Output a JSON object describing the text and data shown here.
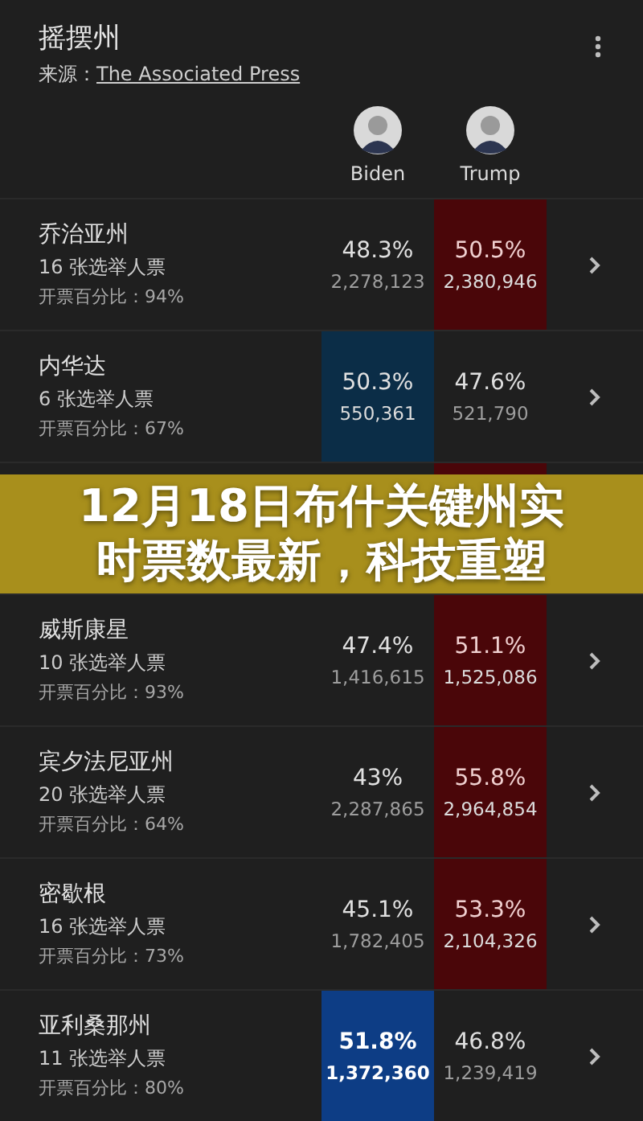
{
  "header": {
    "title": "摇摆州",
    "source_label": "来源：",
    "source_link": "The Associated Press"
  },
  "candidates": [
    {
      "name": "Biden"
    },
    {
      "name": "Trump"
    }
  ],
  "states": [
    {
      "name": "乔治亚州",
      "electors": "16 张选举人票",
      "reported": "开票百分比：94%",
      "biden": {
        "pct": "48.3%",
        "count": "2,278,123",
        "leading": false
      },
      "trump": {
        "pct": "50.5%",
        "count": "2,380,946",
        "leading": true
      },
      "called": false
    },
    {
      "name": "内华达",
      "electors": "6 张选举人票",
      "reported": "开票百分比：67%",
      "biden": {
        "pct": "50.3%",
        "count": "550,361",
        "leading": true
      },
      "trump": {
        "pct": "47.6%",
        "count": "521,790",
        "leading": false
      },
      "called": false
    },
    {
      "biden": {
        "leading": false
      },
      "trump": {
        "leading": true
      },
      "called": false
    },
    {
      "name": "威斯康星",
      "electors": "10 张选举人票",
      "reported": "开票百分比：93%",
      "biden": {
        "pct": "47.4%",
        "count": "1,416,615",
        "leading": false
      },
      "trump": {
        "pct": "51.1%",
        "count": "1,525,086",
        "leading": true
      },
      "called": false
    },
    {
      "name": "宾夕法尼亚州",
      "electors": "20 张选举人票",
      "reported": "开票百分比：64%",
      "biden": {
        "pct": "43%",
        "count": "2,287,865",
        "leading": false
      },
      "trump": {
        "pct": "55.8%",
        "count": "2,964,854",
        "leading": true
      },
      "called": false
    },
    {
      "name": "密歇根",
      "electors": "16 张选举人票",
      "reported": "开票百分比：73%",
      "biden": {
        "pct": "45.1%",
        "count": "1,782,405",
        "leading": false
      },
      "trump": {
        "pct": "53.3%",
        "count": "2,104,326",
        "leading": true
      },
      "called": false
    },
    {
      "name": "亚利桑那州",
      "electors": "11 张选举人票",
      "reported": "开票百分比：80%",
      "biden": {
        "pct": "51.8%",
        "count": "1,372,360",
        "leading": true
      },
      "trump": {
        "pct": "46.8%",
        "count": "1,239,419",
        "leading": false
      },
      "called": true
    }
  ],
  "banner": {
    "text": "12月18日布什关键州实时票数最新，科技重塑"
  }
}
